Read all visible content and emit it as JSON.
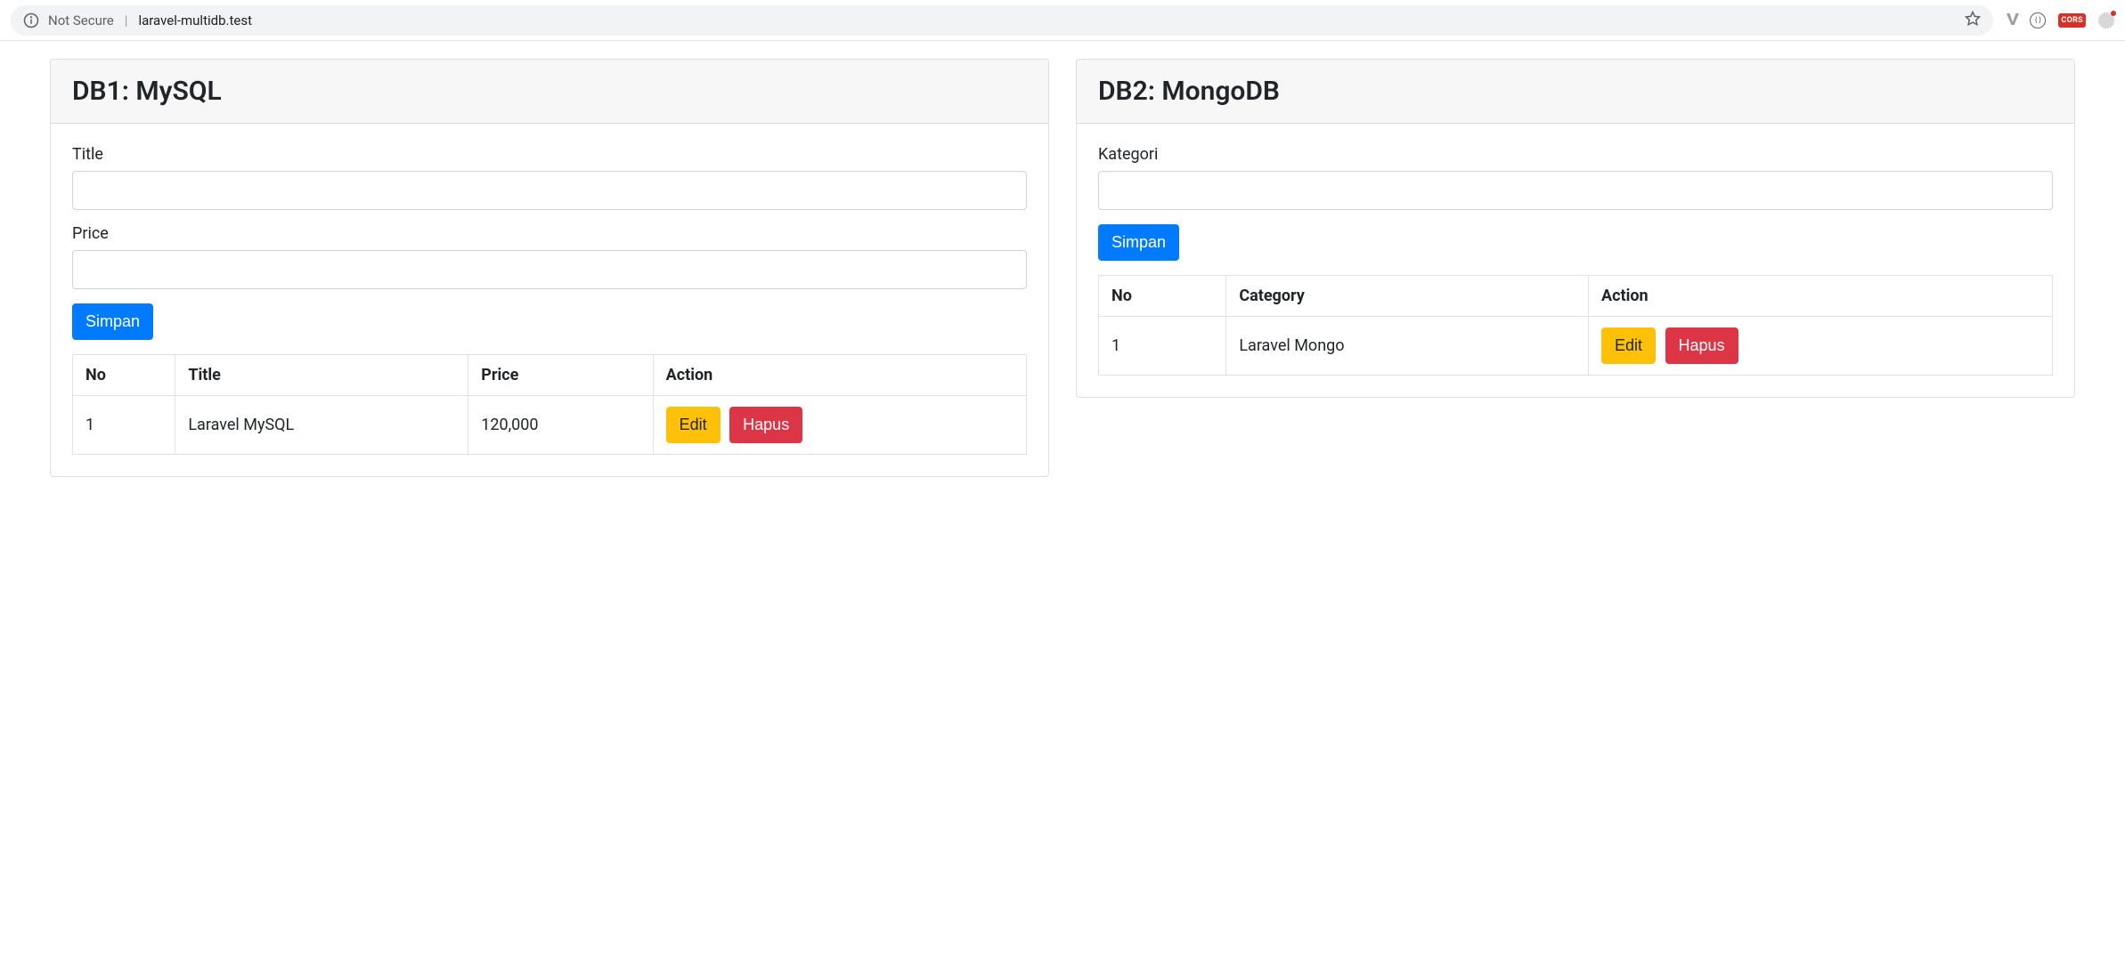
{
  "browser": {
    "not_secure_label": "Not Secure",
    "url": "laravel-multidb.test",
    "cors_label": "CORS"
  },
  "panels": {
    "mysql": {
      "title": "DB1: MySQL",
      "form": {
        "title_label": "Title",
        "price_label": "Price",
        "submit_label": "Simpan"
      },
      "table": {
        "headers": {
          "no": "No",
          "title": "Title",
          "price": "Price",
          "action": "Action"
        },
        "rows": [
          {
            "no": "1",
            "title": "Laravel MySQL",
            "price": "120,000"
          }
        ],
        "actions": {
          "edit": "Edit",
          "delete": "Hapus"
        }
      }
    },
    "mongodb": {
      "title": "DB2: MongoDB",
      "form": {
        "category_label": "Kategori",
        "submit_label": "Simpan"
      },
      "table": {
        "headers": {
          "no": "No",
          "category": "Category",
          "action": "Action"
        },
        "rows": [
          {
            "no": "1",
            "category": "Laravel Mongo"
          }
        ],
        "actions": {
          "edit": "Edit",
          "delete": "Hapus"
        }
      }
    }
  }
}
